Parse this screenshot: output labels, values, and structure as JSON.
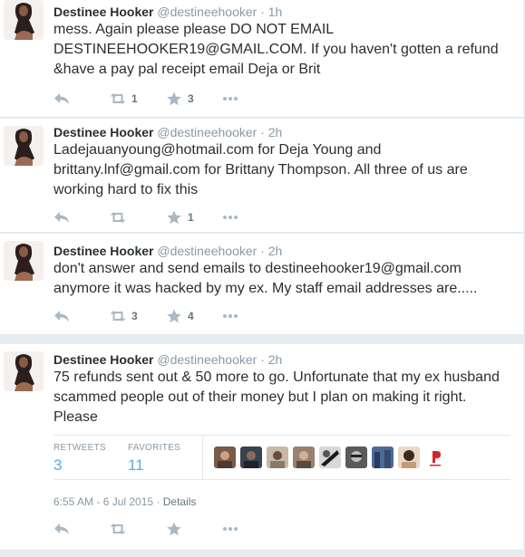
{
  "tweets": [
    {
      "name": "Destinee Hooker",
      "handle": "@destineehooker",
      "time": "· 1h",
      "lines": [
        "mess. Again please please DO NOT EMAIL",
        "DESTINEEHOOKER19@GMAIL.COM. If you haven't gotten a refund",
        "&have a pay pal receipt email Deja or Brit"
      ],
      "retweets": "1",
      "favorites": "3"
    },
    {
      "name": "Destinee Hooker",
      "handle": "@destineehooker",
      "time": "· 2h",
      "lines": [
        "Ladejauanyoung@hotmail.com for Deja Young and",
        "brittany.lnf@gmail.com for Brittany Thompson. All three of us are",
        "working hard to fix this"
      ],
      "retweets": "",
      "favorites": "1"
    },
    {
      "name": "Destinee Hooker",
      "handle": "@destineehooker",
      "time": "· 2h",
      "lines": [
        "don't answer and send emails to destineehooker19@gmail.com",
        "anymore it was hacked by my ex. My staff email addresses are....."
      ],
      "retweets": "3",
      "favorites": "4"
    },
    {
      "name": "Destinee Hooker",
      "handle": "@destineehooker",
      "time": "· 2h",
      "lines": [
        "75 refunds sent out & 50 more to go. Unfortunate that my ex husband",
        "scammed people out of their money but I plan on making it right.",
        "Please"
      ],
      "stats": {
        "retweets_label": "RETWEETS",
        "retweets": "3",
        "favorites_label": "FAVORITES",
        "favorites": "11"
      },
      "timestamp": "6:55 AM - 6 Jul 2015",
      "separator": " · ",
      "details": "Details"
    }
  ],
  "icons": {
    "reply": "reply-icon",
    "retweet": "retweet-icon",
    "favorite": "star-icon",
    "more": "more-icon"
  },
  "favoriter_avatars": [
    "favoriter-avatar-1",
    "favoriter-avatar-2",
    "favoriter-avatar-3",
    "favoriter-avatar-4",
    "favoriter-avatar-5",
    "favoriter-avatar-6",
    "favoriter-avatar-7",
    "favoriter-avatar-8",
    "favoriter-avatar-9"
  ],
  "colors": {
    "accent": "#55acee",
    "icon_gray": "#aab8c2",
    "meta_gray": "#8899a6",
    "text": "#292f33",
    "background": "#e6ecf0"
  }
}
